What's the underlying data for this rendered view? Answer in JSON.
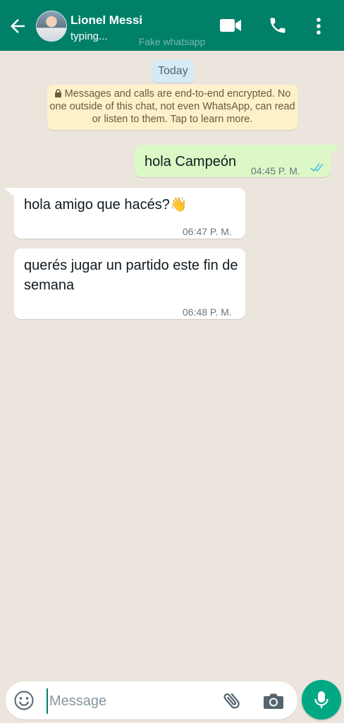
{
  "header": {
    "contact_name": "Lionel Messi",
    "status": "typing...",
    "watermark": "Fake whatsapp",
    "icons": [
      "back-arrow-icon",
      "video-call-icon",
      "phone-icon",
      "more-vert-icon"
    ]
  },
  "chat": {
    "date_label": "Today",
    "encryption_notice": "Messages and calls are end-to-end encrypted. No one outside of this chat, not even WhatsApp, can read or listen to them. Tap to learn more.",
    "messages": [
      {
        "direction": "outgoing",
        "text": "hola Campeón",
        "time": "04:45 P. M.",
        "status": "read"
      },
      {
        "direction": "incoming",
        "text": "hola amigo que hacés?👋",
        "time": "06:47 P. M."
      },
      {
        "direction": "incoming",
        "text": "querés jugar un partido este fin de semana",
        "time": "06:48 P. M."
      }
    ]
  },
  "input_bar": {
    "placeholder": "Message",
    "value": "",
    "icons": [
      "emoji-icon",
      "attach-icon",
      "camera-icon",
      "mic-icon"
    ]
  },
  "colors": {
    "header_bg": "#008069",
    "chat_bg": "#ece5dd",
    "outgoing_bubble": "#dcf8c6",
    "incoming_bubble": "#ffffff",
    "accent": "#00a884",
    "read_ticks": "#53bdeb",
    "notice_bg": "#fef1c9",
    "date_pill_bg": "#d4eaf4"
  }
}
